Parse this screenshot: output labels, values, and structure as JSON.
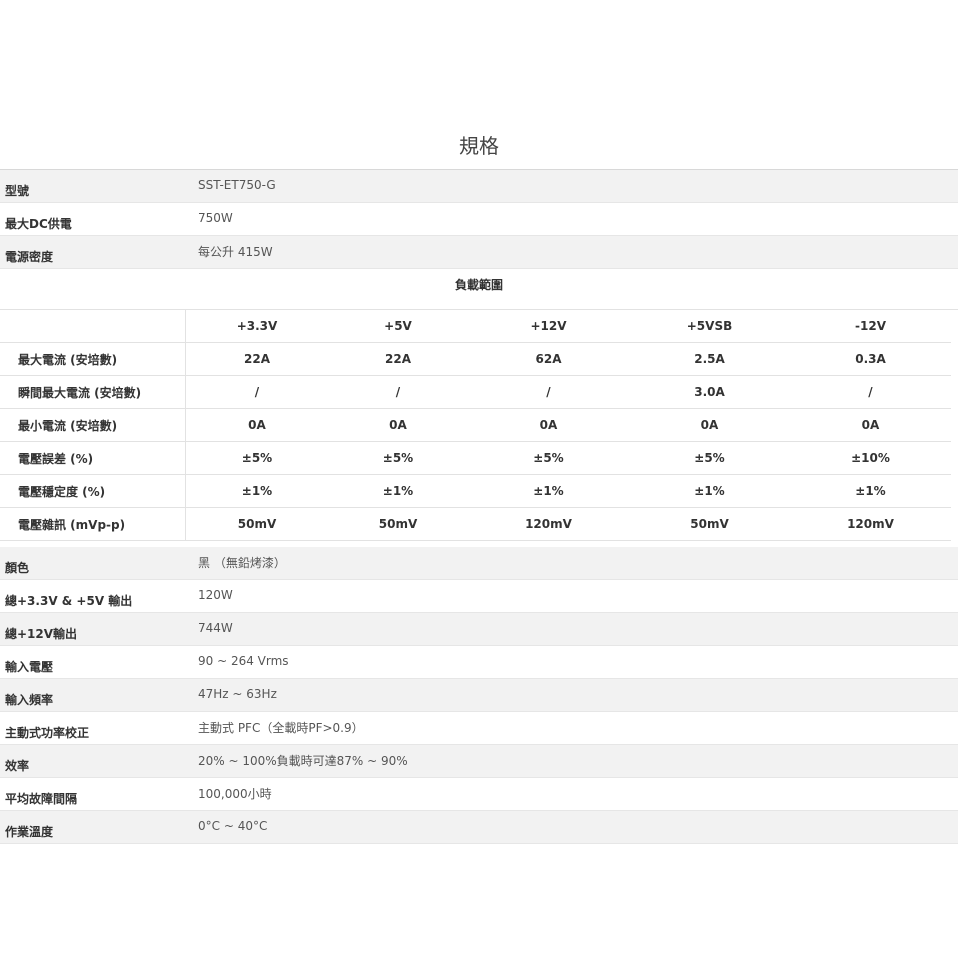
{
  "title": "規格",
  "top_rows": [
    {
      "label": "型號",
      "value": "SST-ET750-G"
    },
    {
      "label": "最大DC供電",
      "value": "750W"
    },
    {
      "label": "電源密度",
      "value": "每公升 415W"
    }
  ],
  "load_table": {
    "title": "負載範圍",
    "columns": [
      "+3.3V",
      "+5V",
      "+12V",
      "+5VSB",
      "-12V"
    ],
    "rows": [
      {
        "label": "最大電流 (安培數)",
        "values": [
          "22A",
          "22A",
          "62A",
          "2.5A",
          "0.3A"
        ]
      },
      {
        "label": "瞬間最大電流 (安培數)",
        "values": [
          "/",
          "/",
          "/",
          "3.0A",
          "/"
        ]
      },
      {
        "label": "最小電流 (安培數)",
        "values": [
          "0A",
          "0A",
          "0A",
          "0A",
          "0A"
        ]
      },
      {
        "label": "電壓誤差 (%)",
        "values": [
          "±5%",
          "±5%",
          "±5%",
          "±5%",
          "±10%"
        ]
      },
      {
        "label": "電壓穩定度 (%)",
        "values": [
          "±1%",
          "±1%",
          "±1%",
          "±1%",
          "±1%"
        ]
      },
      {
        "label": "電壓雜訊 (mVp-p)",
        "values": [
          "50mV",
          "50mV",
          "120mV",
          "50mV",
          "120mV"
        ]
      }
    ]
  },
  "bottom_rows": [
    {
      "label": "顏色",
      "value": "黑 （無鉛烤漆）"
    },
    {
      "label": "總+3.3V & +5V 輸出",
      "value": "120W"
    },
    {
      "label": "總+12V輸出",
      "value": "744W"
    },
    {
      "label": "輸入電壓",
      "value": "90 ~ 264 Vrms"
    },
    {
      "label": "輸入頻率",
      "value": "47Hz ~ 63Hz"
    },
    {
      "label": "主動式功率校正",
      "value": "主動式 PFC（全載時PF>0.9）"
    },
    {
      "label": "效率",
      "value": "20% ~ 100%負載時可達87% ~ 90%"
    },
    {
      "label": "平均故障間隔",
      "value": "100,000小時"
    },
    {
      "label": "作業溫度",
      "value": "0°C ~ 40°C"
    }
  ]
}
